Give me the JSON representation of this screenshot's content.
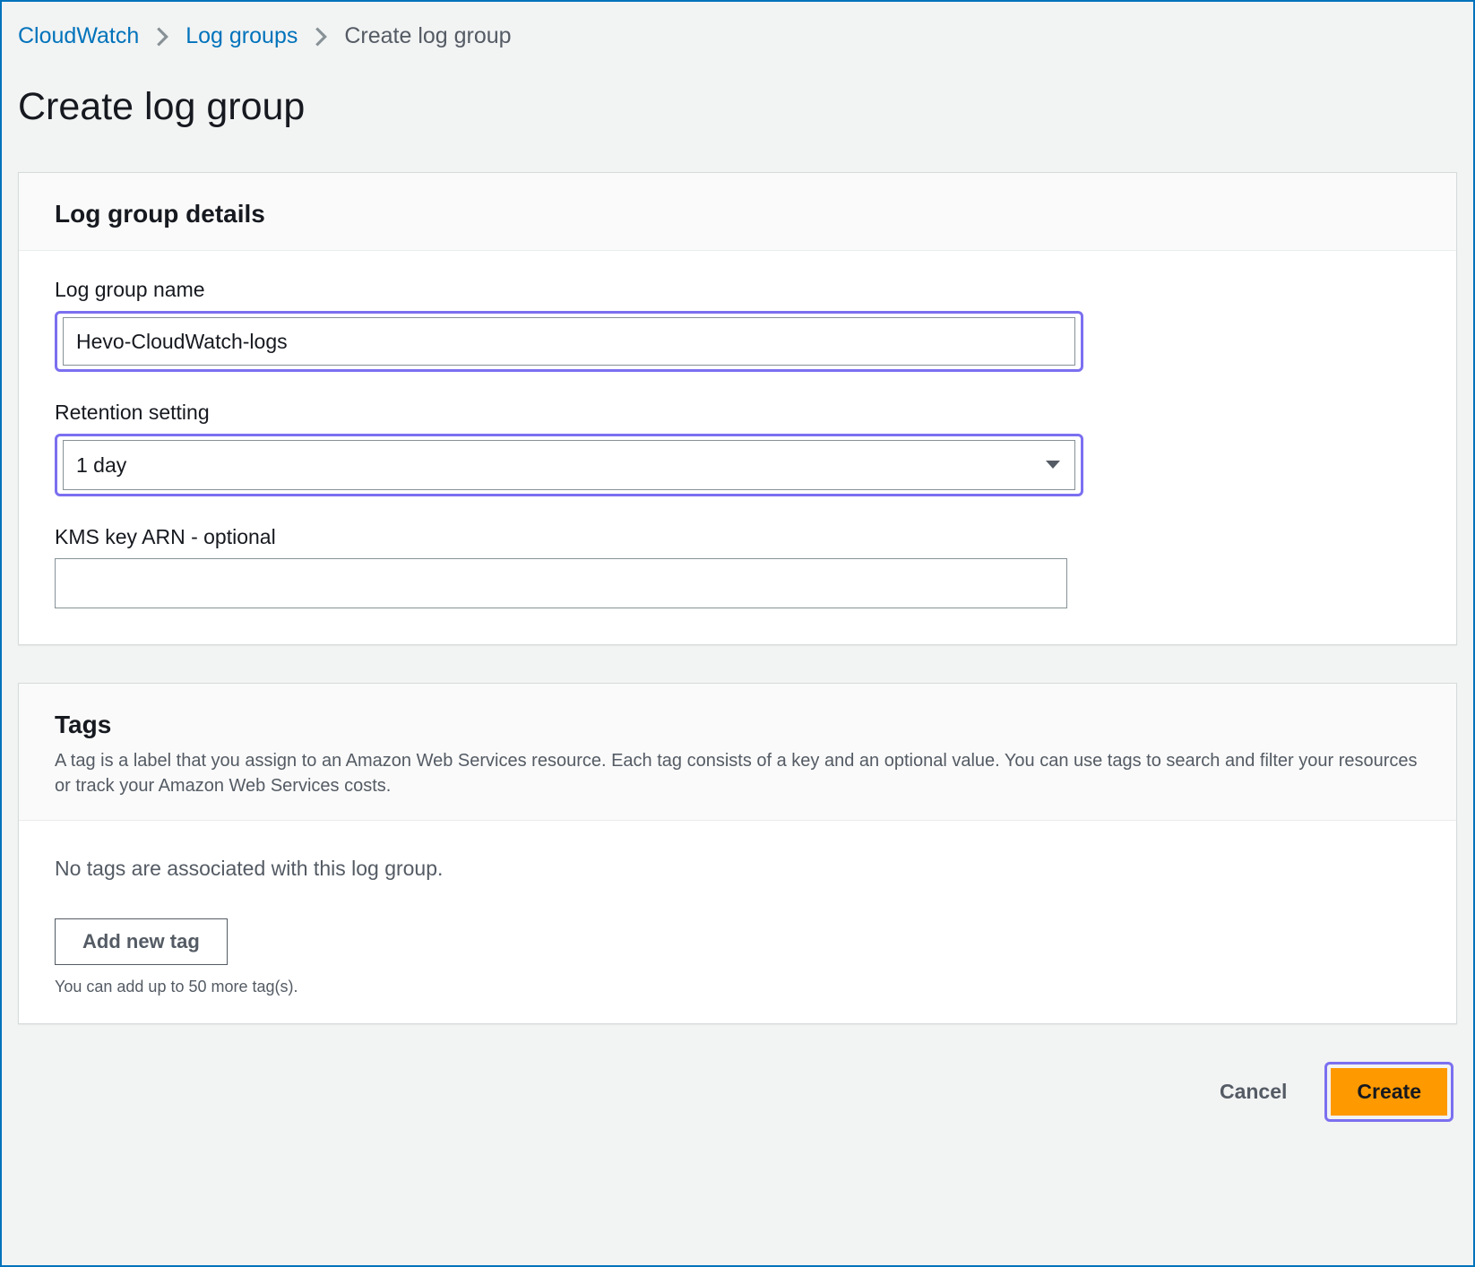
{
  "breadcrumb": {
    "items": [
      {
        "label": "CloudWatch"
      },
      {
        "label": "Log groups"
      }
    ],
    "current": "Create log group"
  },
  "page": {
    "title": "Create log group"
  },
  "details_panel": {
    "heading": "Log group details",
    "name_label": "Log group name",
    "name_value": "Hevo-CloudWatch-logs",
    "retention_label": "Retention setting",
    "retention_value": "1 day",
    "kms_label": "KMS key ARN - optional",
    "kms_value": ""
  },
  "tags_panel": {
    "heading": "Tags",
    "description": "A tag is a label that you assign to an Amazon Web Services resource. Each tag consists of a key and an optional value. You can use tags to search and filter your resources or track your Amazon Web Services costs.",
    "empty_text": "No tags are associated with this log group.",
    "add_button": "Add new tag",
    "limit_text": "You can add up to 50 more tag(s)."
  },
  "footer": {
    "cancel": "Cancel",
    "create": "Create"
  }
}
